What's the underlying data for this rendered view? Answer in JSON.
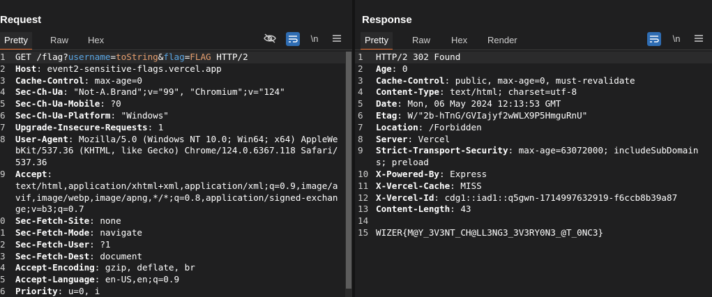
{
  "request": {
    "title": "Request",
    "tabs": [
      "Pretty",
      "Raw",
      "Hex"
    ],
    "newline_label": "\\n",
    "lines": [
      {
        "n": "1",
        "parts": [
          [
            "GET /flag?",
            "k"
          ],
          [
            "username",
            "param"
          ],
          [
            "=",
            "k"
          ],
          [
            "toString",
            "val"
          ],
          [
            "&",
            "k"
          ],
          [
            "flag",
            "param"
          ],
          [
            "=",
            "k"
          ],
          [
            "FLAG",
            "val"
          ],
          [
            " HTTP/2",
            "k"
          ]
        ]
      },
      {
        "n": "2",
        "parts": [
          [
            "Host",
            "bold"
          ],
          [
            ": event2-sensitive-flags.vercel.app",
            "k"
          ]
        ]
      },
      {
        "n": "3",
        "parts": [
          [
            "Cache-Control",
            "bold"
          ],
          [
            ": max-age=0",
            "k"
          ]
        ]
      },
      {
        "n": "4",
        "parts": [
          [
            "Sec-Ch-Ua",
            "bold"
          ],
          [
            ": \"Not-A.Brand\";v=\"99\", \"Chromium\";v=\"124\"",
            "k"
          ]
        ]
      },
      {
        "n": "5",
        "parts": [
          [
            "Sec-Ch-Ua-Mobile",
            "bold"
          ],
          [
            ": ?0",
            "k"
          ]
        ]
      },
      {
        "n": "6",
        "parts": [
          [
            "Sec-Ch-Ua-Platform",
            "bold"
          ],
          [
            ": \"Windows\"",
            "k"
          ]
        ]
      },
      {
        "n": "7",
        "parts": [
          [
            "Upgrade-Insecure-Requests",
            "bold"
          ],
          [
            ": 1",
            "k"
          ]
        ]
      },
      {
        "n": "8",
        "parts": [
          [
            "User-Agent",
            "bold"
          ],
          [
            ": Mozilla/5.0 (Windows NT 10.0; Win64; x64) AppleWebKit/537.36 (KHTML, like Gecko) Chrome/124.0.6367.118 Safari/537.36",
            "k"
          ]
        ]
      },
      {
        "n": "9",
        "parts": [
          [
            "Accept",
            "bold"
          ],
          [
            ":\ntext/html,application/xhtml+xml,application/xml;q=0.9,image/avif,image/webp,image/apng,*/*;q=0.8,application/signed-exchange;v=b3;q=0.7",
            "k"
          ]
        ]
      },
      {
        "n": "0",
        "parts": [
          [
            "Sec-Fetch-Site",
            "bold"
          ],
          [
            ": none",
            "k"
          ]
        ]
      },
      {
        "n": "1",
        "parts": [
          [
            "Sec-Fetch-Mode",
            "bold"
          ],
          [
            ": navigate",
            "k"
          ]
        ]
      },
      {
        "n": "2",
        "parts": [
          [
            "Sec-Fetch-User",
            "bold"
          ],
          [
            ": ?1",
            "k"
          ]
        ]
      },
      {
        "n": "3",
        "parts": [
          [
            "Sec-Fetch-Dest",
            "bold"
          ],
          [
            ": document",
            "k"
          ]
        ]
      },
      {
        "n": "4",
        "parts": [
          [
            "Accept-Encoding",
            "bold"
          ],
          [
            ": gzip, deflate, br",
            "k"
          ]
        ]
      },
      {
        "n": "5",
        "parts": [
          [
            "Accept-Language",
            "bold"
          ],
          [
            ": en-US,en;q=0.9",
            "k"
          ]
        ]
      },
      {
        "n": "6",
        "parts": [
          [
            "Priority",
            "bold"
          ],
          [
            ": u=0, i",
            "k"
          ]
        ]
      }
    ]
  },
  "response": {
    "title": "Response",
    "tabs": [
      "Pretty",
      "Raw",
      "Hex",
      "Render"
    ],
    "newline_label": "\\n",
    "lines": [
      {
        "n": "1",
        "parts": [
          [
            "HTTP/2 302 Found",
            "k"
          ]
        ]
      },
      {
        "n": "2",
        "parts": [
          [
            "Age",
            "bold"
          ],
          [
            ": 0",
            "k"
          ]
        ]
      },
      {
        "n": "3",
        "parts": [
          [
            "Cache-Control",
            "bold"
          ],
          [
            ": public, max-age=0, must-revalidate",
            "k"
          ]
        ]
      },
      {
        "n": "4",
        "parts": [
          [
            "Content-Type",
            "bold"
          ],
          [
            ": text/html; charset=utf-8",
            "k"
          ]
        ]
      },
      {
        "n": "5",
        "parts": [
          [
            "Date",
            "bold"
          ],
          [
            ": Mon, 06 May 2024 12:13:53 GMT",
            "k"
          ]
        ]
      },
      {
        "n": "6",
        "parts": [
          [
            "Etag",
            "bold"
          ],
          [
            ": W/\"2b-hTnG/GVIajyf2wWLX9P5HmguRnU\"",
            "k"
          ]
        ]
      },
      {
        "n": "7",
        "parts": [
          [
            "Location",
            "bold"
          ],
          [
            ": /Forbidden",
            "k"
          ]
        ]
      },
      {
        "n": "8",
        "parts": [
          [
            "Server",
            "bold"
          ],
          [
            ": Vercel",
            "k"
          ]
        ]
      },
      {
        "n": "9",
        "parts": [
          [
            "Strict-Transport-Security",
            "bold"
          ],
          [
            ": max-age=63072000; includeSubDomains; preload",
            "k"
          ]
        ]
      },
      {
        "n": "10",
        "parts": [
          [
            "X-Powered-By",
            "bold"
          ],
          [
            ": Express",
            "k"
          ]
        ]
      },
      {
        "n": "11",
        "parts": [
          [
            "X-Vercel-Cache",
            "bold"
          ],
          [
            ": MISS",
            "k"
          ]
        ]
      },
      {
        "n": "12",
        "parts": [
          [
            "X-Vercel-Id",
            "bold"
          ],
          [
            ": cdg1::iad1::q5gwn-1714997632919-f6ccb8b39a87",
            "k"
          ]
        ]
      },
      {
        "n": "13",
        "parts": [
          [
            "Content-Length",
            "bold"
          ],
          [
            ": 43",
            "k"
          ]
        ]
      },
      {
        "n": "14",
        "parts": [
          [
            "",
            "k"
          ]
        ]
      },
      {
        "n": "15",
        "parts": [
          [
            "WIZER{M@Y_3V3NT_CH@LL3NG3_3V3RY0N3_@T_0NC3}",
            "k"
          ]
        ]
      }
    ]
  },
  "icons": {
    "hide": "eye-off-icon",
    "wrap": "wrap-icon",
    "menu": "hamburger-icon",
    "layout": [
      "split-horizontal-icon",
      "split-vertical-icon",
      "single-pane-icon"
    ]
  },
  "colors": {
    "accent": "#e8692a",
    "param": "#5aa7e6",
    "value": "#e8a070",
    "blue": "#2f6db3"
  }
}
